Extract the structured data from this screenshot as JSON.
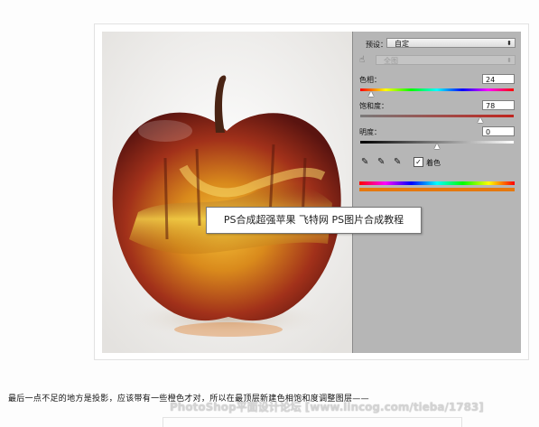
{
  "caption": "PS合成超强苹果 飞特网 PS图片合成教程",
  "panel": {
    "preset_label": "预设：",
    "preset_value": "自定",
    "range_value": "全图",
    "hue_label": "色相：",
    "hue_value": "24",
    "hue_fraction": 0.07,
    "sat_label": "饱和度：",
    "sat_value": "78",
    "sat_fraction": 0.78,
    "light_label": "明度：",
    "light_value": "0",
    "light_fraction": 0.5,
    "colorize_label": "着色",
    "colorize_checked": true
  },
  "paragraph": "最后一点不足的地方是投影，应该带有一些橙色才对，所以在最顶层新建色相饱和度调整图层——",
  "watermark": "PhotoShop平面设计论坛 [www.lincog.com/tieba/1783]",
  "colors": {
    "accent": "#e6780e",
    "panel_bg": "#b6b6b6"
  }
}
